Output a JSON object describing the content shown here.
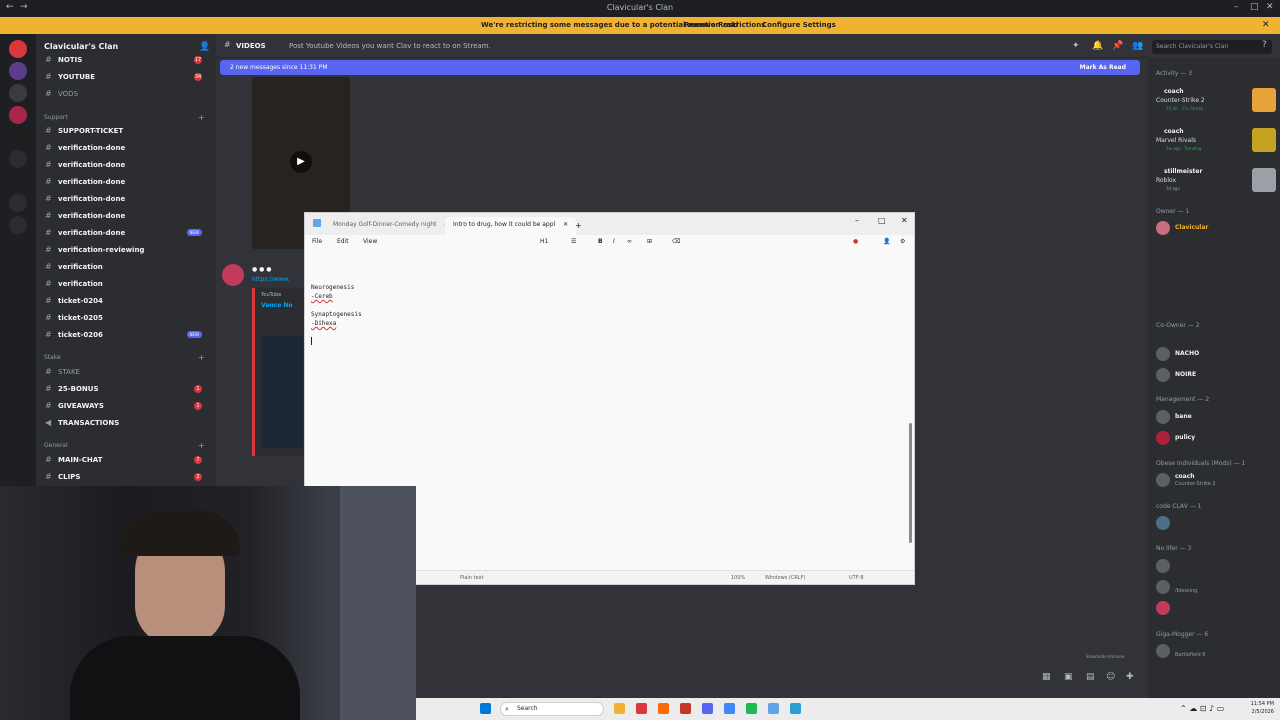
{
  "window": {
    "title": "Clavicular's Clan"
  },
  "banner": {
    "message": "We're restricting some messages due to a potential mention raid",
    "remove_btn": "Remove Restrictions",
    "configure_btn": "Configure Settings"
  },
  "server": {
    "name": "Clavicular's Clan"
  },
  "channels": [
    {
      "label": "NOTIS",
      "badge": "17",
      "bold": true
    },
    {
      "label": "YOUTUBE",
      "badge": "34",
      "bold": true
    },
    {
      "label": "VODS",
      "badge": "",
      "bold": false
    },
    {
      "label": "SUPPORT-TICKET",
      "badge": "",
      "bold": true
    },
    {
      "label": "verification-done",
      "badge": "",
      "bold": true
    },
    {
      "label": "verification-done",
      "badge": "",
      "bold": true
    },
    {
      "label": "verification-done",
      "badge": "",
      "bold": true
    },
    {
      "label": "verification-done",
      "badge": "",
      "bold": true
    },
    {
      "label": "verification-done",
      "badge": "",
      "bold": true
    },
    {
      "label": "verification-done",
      "badge": "NEW",
      "bold": true
    },
    {
      "label": "verification-reviewing",
      "badge": "",
      "bold": true
    },
    {
      "label": "verification",
      "badge": "",
      "bold": true
    },
    {
      "label": "verification",
      "badge": "",
      "bold": true
    },
    {
      "label": "ticket-0204",
      "badge": "",
      "bold": true
    },
    {
      "label": "ticket-0205",
      "badge": "",
      "bold": true
    },
    {
      "label": "ticket-0206",
      "badge": "NEW",
      "bold": true
    },
    {
      "label": "STAKE",
      "badge": "",
      "bold": false
    },
    {
      "label": "25-BONUS",
      "badge": "1",
      "bold": true
    },
    {
      "label": "GIVEAWAYS",
      "badge": "1",
      "bold": true
    },
    {
      "label": "TRANSACTIONS",
      "badge": "",
      "bold": true
    },
    {
      "label": "MAIN-CHAT",
      "badge": "7",
      "bold": true
    },
    {
      "label": "CLIPS",
      "badge": "2",
      "bold": true
    }
  ],
  "categories": {
    "support": "Support",
    "stake": "Stake",
    "general": "General"
  },
  "channel_bar": {
    "name": "VIDEOS",
    "topic": "Post Youtube Videos you want Clav to react to on Stream.",
    "search_placeholder": "Search Clavicular's Clan"
  },
  "new_messages": {
    "text": "2 new messages since 11:31 PM",
    "mark_read": "Mark As Read"
  },
  "message": {
    "link": "https://www.",
    "embed_provider": "YouTube",
    "embed_title": "Vance No"
  },
  "members": {
    "activity_header": "Activity — 3",
    "activities": [
      {
        "name": "coach",
        "game": "Counter-Strike 2",
        "meta": "25:40 · 37x Streak"
      },
      {
        "name": "coach",
        "game": "Marvel Rivals",
        "meta": "2w ago · Trending"
      },
      {
        "name": "stillmeister",
        "game": "Roblox",
        "meta": "3d ago"
      }
    ],
    "groups": [
      {
        "header": "Owner — 1",
        "members": [
          {
            "name": "Clavicular",
            "status": ""
          }
        ]
      },
      {
        "header": "Co-Owner — 2",
        "members": [
          {
            "name": "NACHO",
            "status": ""
          },
          {
            "name": "NOIRE",
            "status": ""
          }
        ]
      },
      {
        "header": "Management — 2",
        "members": [
          {
            "name": "bane",
            "status": ""
          },
          {
            "name": "pulicy",
            "status": ""
          }
        ]
      },
      {
        "header": "Obese Individuals (Mods) — 1",
        "members": [
          {
            "name": "coach",
            "status": "Counter-Strike 2"
          }
        ]
      },
      {
        "header": "code CLAV — 1",
        "members": [
          {
            "name": "",
            "status": ""
          }
        ]
      },
      {
        "header": "No lifer — 3",
        "members": [
          {
            "name": "",
            "status": ""
          },
          {
            "name": "",
            "status": "/blessing"
          },
          {
            "name": "",
            "status": ""
          }
        ]
      },
      {
        "header": "Giga-Mogger — 6",
        "members": [
          {
            "name": "",
            "status": "Battlefield 6"
          }
        ]
      }
    ],
    "slowmode": "Slowmode Immune"
  },
  "notepad": {
    "tabs": [
      "Monday Golf-Dinner-Comedy night",
      "Intro to drug, how it could be appl"
    ],
    "menu": [
      "File",
      "Edit",
      "View"
    ],
    "heading_btn": "H1",
    "lines": [
      "Neurogenesis",
      "-Cereb",
      "",
      "Synaptogenesis",
      "-Dihexa"
    ],
    "status": {
      "format": "Plain text",
      "zoom": "100%",
      "eol": "Windows (CRLF)",
      "encoding": "UTF-8"
    }
  },
  "taskbar": {
    "search": "Search",
    "time": "11:54 PM",
    "date": "2/5/2026"
  }
}
